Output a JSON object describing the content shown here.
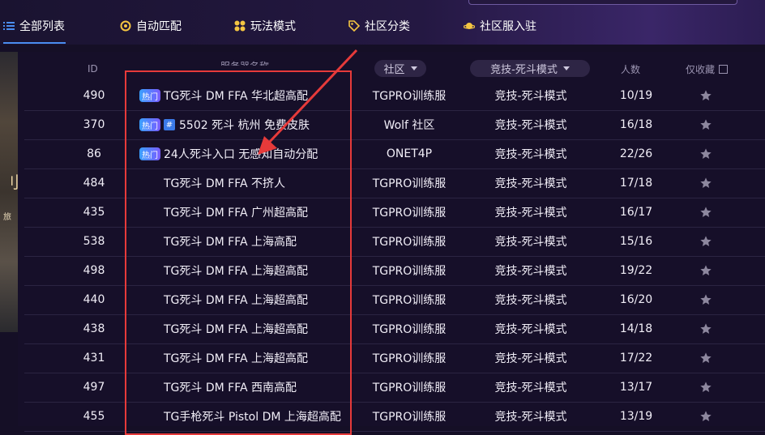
{
  "nav": {
    "tabs": [
      {
        "label": "全部列表",
        "icon": "list-icon"
      },
      {
        "label": "自动匹配",
        "icon": "target-icon"
      },
      {
        "label": "玩法模式",
        "icon": "grid-icon"
      },
      {
        "label": "社区分类",
        "icon": "tag-icon"
      },
      {
        "label": "社区服入驻",
        "icon": "planet-icon"
      }
    ],
    "active_color": "#4a8df0"
  },
  "poster": {
    "glyph1": "刂",
    "glyph2": "旅"
  },
  "table": {
    "headers": {
      "id": "ID",
      "name": "服务器名称",
      "community": "社区",
      "mode": "竞技-死斗模式",
      "count": "人数",
      "fav": "仅收藏"
    },
    "rows": [
      {
        "id": "490",
        "hot": true,
        "badge": "热门",
        "hash": false,
        "name": "TG死斗 DM FFA 华北超高配",
        "community": "TGPRO训练服",
        "mode": "竞技-死斗模式",
        "count": "10/19"
      },
      {
        "id": "370",
        "hot": true,
        "badge": "热门",
        "hash": true,
        "hash_label": "#",
        "name": "5502 死斗 杭州 免费皮肤",
        "community": "Wolf 社区",
        "mode": "竞技-死斗模式",
        "count": "16/18"
      },
      {
        "id": "86",
        "hot": true,
        "badge": "热门",
        "hash": false,
        "name": "24人死斗入口 无感知自动分配",
        "community": "ONET4P",
        "mode": "竞技-死斗模式",
        "count": "22/26"
      },
      {
        "id": "484",
        "hot": false,
        "hash": false,
        "name": "TG死斗 DM FFA 不挤人",
        "community": "TGPRO训练服",
        "mode": "竞技-死斗模式",
        "count": "17/18"
      },
      {
        "id": "435",
        "hot": false,
        "hash": false,
        "name": "TG死斗 DM FFA 广州超高配",
        "community": "TGPRO训练服",
        "mode": "竞技-死斗模式",
        "count": "16/17"
      },
      {
        "id": "538",
        "hot": false,
        "hash": false,
        "name": "TG死斗 DM FFA 上海高配",
        "community": "TGPRO训练服",
        "mode": "竞技-死斗模式",
        "count": "15/16"
      },
      {
        "id": "498",
        "hot": false,
        "hash": false,
        "name": "TG死斗 DM FFA 上海超高配",
        "community": "TGPRO训练服",
        "mode": "竞技-死斗模式",
        "count": "19/22"
      },
      {
        "id": "440",
        "hot": false,
        "hash": false,
        "name": "TG死斗 DM FFA 上海超高配",
        "community": "TGPRO训练服",
        "mode": "竞技-死斗模式",
        "count": "16/20"
      },
      {
        "id": "438",
        "hot": false,
        "hash": false,
        "name": "TG死斗 DM FFA 上海超高配",
        "community": "TGPRO训练服",
        "mode": "竞技-死斗模式",
        "count": "14/18"
      },
      {
        "id": "431",
        "hot": false,
        "hash": false,
        "name": "TG死斗 DM FFA 上海超高配",
        "community": "TGPRO训练服",
        "mode": "竞技-死斗模式",
        "count": "17/22"
      },
      {
        "id": "497",
        "hot": false,
        "hash": false,
        "name": "TG死斗 DM FFA 西南高配",
        "community": "TGPRO训练服",
        "mode": "竞技-死斗模式",
        "count": "13/17"
      },
      {
        "id": "455",
        "hot": false,
        "hash": false,
        "name": "TG手枪死斗 Pistol DM 上海超高配",
        "community": "TGPRO训练服",
        "mode": "竞技-死斗模式",
        "count": "13/19"
      }
    ]
  },
  "colors": {
    "annotation_red": "#e63a3a",
    "star_gray": "#8d879e"
  }
}
